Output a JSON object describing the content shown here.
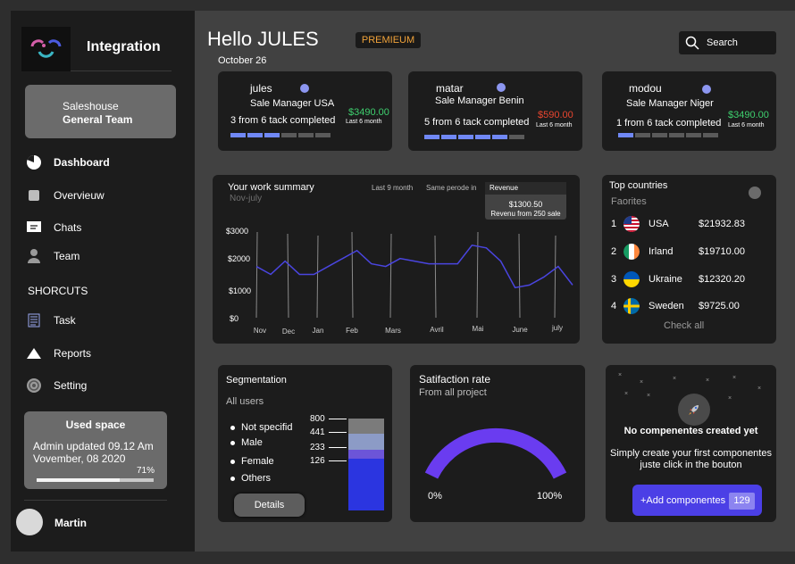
{
  "sidebar": {
    "app_name": "Integration",
    "team": {
      "line1": "Saleshouse",
      "line2": "General Team"
    },
    "nav": [
      {
        "label": "Dashboard",
        "icon": "pie-chart-icon"
      },
      {
        "label": "Overvieuw",
        "icon": "square-icon"
      },
      {
        "label": "Chats",
        "icon": "chat-icon"
      },
      {
        "label": "Team",
        "icon": "person-icon"
      }
    ],
    "section_label": "SHORCUTS",
    "shortcuts": [
      {
        "label": "Task",
        "icon": "list-icon"
      },
      {
        "label": "Reports",
        "icon": "triangle-icon"
      },
      {
        "label": "Setting",
        "icon": "gear-icon"
      }
    ],
    "storage": {
      "title": "Used space",
      "line1": "Admin  updated 09.12 Am",
      "line2": "Vovember, 08 2020",
      "percent_label": "71%",
      "fraction": 0.71
    },
    "user_name": "Martin"
  },
  "header": {
    "greeting": "Hello JULES",
    "date": "October 26",
    "badge": "PREMIEUM",
    "search_label": "Search"
  },
  "managers": [
    {
      "name": "jules",
      "role": "Sale Manager USA",
      "progress": "3 from 6 tack completed",
      "amount": "$3490.00",
      "period": "Last 6 month",
      "amount_color": "#3ecf6e",
      "completed": 3
    },
    {
      "name": "matar",
      "role": "Sale Manager Benin",
      "progress": "5 from 6 tack completed",
      "amount": "$590.00",
      "period": "Last 6 month",
      "amount_color": "#e8452f",
      "completed": 5
    },
    {
      "name": "modou",
      "role": "Sale Manager Niger",
      "progress": "1 from 6 tack completed",
      "amount": "$3490.00",
      "period": "Last 6 month",
      "amount_color": "#3ecf6e",
      "completed": 1
    }
  ],
  "work_summary": {
    "title": "Your work summary",
    "subtitle": "Nov-july",
    "option1": "Last 9 month",
    "option2": "Same perode in",
    "tooltip": {
      "header": "Revenue",
      "value": "$1300.50",
      "caption": "Revenu from 250 sale"
    }
  },
  "chart_data": {
    "type": "line",
    "x": [
      "Nov",
      "Dec",
      "Jan",
      "Feb",
      "Mars",
      "Avril",
      "Mai",
      "June",
      "july"
    ],
    "yticks": [
      "$3000",
      "$2000",
      "$1000",
      "$0"
    ],
    "ylim": [
      0,
      3500
    ],
    "series": [
      {
        "values": [
          2000,
          1700,
          2200,
          1700,
          1700,
          2000,
          2300,
          2600,
          2100,
          2000,
          2300,
          2200,
          2100,
          2100,
          2100,
          2800,
          2700,
          2200,
          1200,
          1300,
          1600,
          2000,
          1300
        ]
      }
    ],
    "line_color": "#4a45e0",
    "grid": true
  },
  "countries": {
    "title": "Top countries",
    "subtitle": "Faorites",
    "items": [
      {
        "rank": "1",
        "name": "USA",
        "value": "$21932.83",
        "flag": "usa-flag-icon"
      },
      {
        "rank": "2",
        "name": "Irland",
        "value": "$19710.00",
        "flag": "ireland-flag-icon"
      },
      {
        "rank": "3",
        "name": "Ukraine",
        "value": "$12320.20",
        "flag": "ukraine-flag-icon"
      },
      {
        "rank": "4",
        "name": "Sweden",
        "value": "$9725.00",
        "flag": "sweden-flag-icon"
      }
    ],
    "link": "Check all"
  },
  "segmentation": {
    "title": "Segmentation",
    "filter": "All users",
    "legend": [
      "Not specifid",
      "Male",
      "Female",
      "Others"
    ],
    "values": [
      "800",
      "441",
      "233",
      "126"
    ],
    "button": "Details"
  },
  "satisfaction": {
    "title": "Satifaction rate",
    "subtitle": "From all project",
    "min_label": "0%",
    "max_label": "100%",
    "rate": 1.0
  },
  "components": {
    "title": "No compenentes created yet",
    "line1": "Simply create your first  componentes",
    "line2": "juste click in the bouton",
    "button": "+Add componentes",
    "count": "129"
  }
}
